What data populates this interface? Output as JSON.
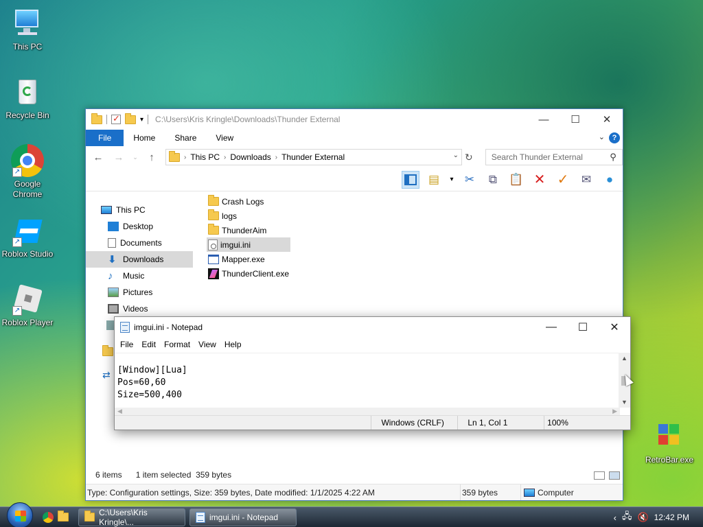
{
  "desktop": {
    "icons": [
      {
        "label": "This PC"
      },
      {
        "label": "Recycle Bin"
      },
      {
        "label": "Google Chrome"
      },
      {
        "label": "Roblox Studio"
      },
      {
        "label": "Roblox Player"
      },
      {
        "label": "RetroBar.exe"
      }
    ]
  },
  "explorer": {
    "title": "C:\\Users\\Kris Kringle\\Downloads\\Thunder External",
    "ribbon_tabs": [
      "File",
      "Home",
      "Share",
      "View"
    ],
    "breadcrumb": [
      "This PC",
      "Downloads",
      "Thunder External"
    ],
    "search_placeholder": "Search Thunder External",
    "sidebar": [
      "This PC",
      "Desktop",
      "Documents",
      "Downloads",
      "Music",
      "Pictures",
      "Videos"
    ],
    "files": [
      "Crash Logs",
      "logs",
      "ThunderAim",
      "imgui.ini",
      "Mapper.exe",
      "ThunderClient.exe"
    ],
    "status": {
      "items": "6 items",
      "selected": "1 item selected  359 bytes",
      "details": "Type: Configuration settings, Size: 359 bytes, Date modified: 1/1/2025 4:22 AM",
      "size": "359 bytes",
      "location": "Computer"
    }
  },
  "notepad": {
    "title": "imgui.ini - Notepad",
    "menu": [
      "File",
      "Edit",
      "Format",
      "View",
      "Help"
    ],
    "lines": [
      "[Window][Lua]",
      "Pos=60,60",
      "Size=500,400"
    ],
    "status": {
      "encoding": "Windows (CRLF)",
      "position": "Ln 1, Col 1",
      "zoom": "100%"
    }
  },
  "taskbar": {
    "buttons": [
      "C:\\Users\\Kris Kringle\\...",
      "imgui.ini - Notepad"
    ],
    "clock": "12:42 PM"
  }
}
